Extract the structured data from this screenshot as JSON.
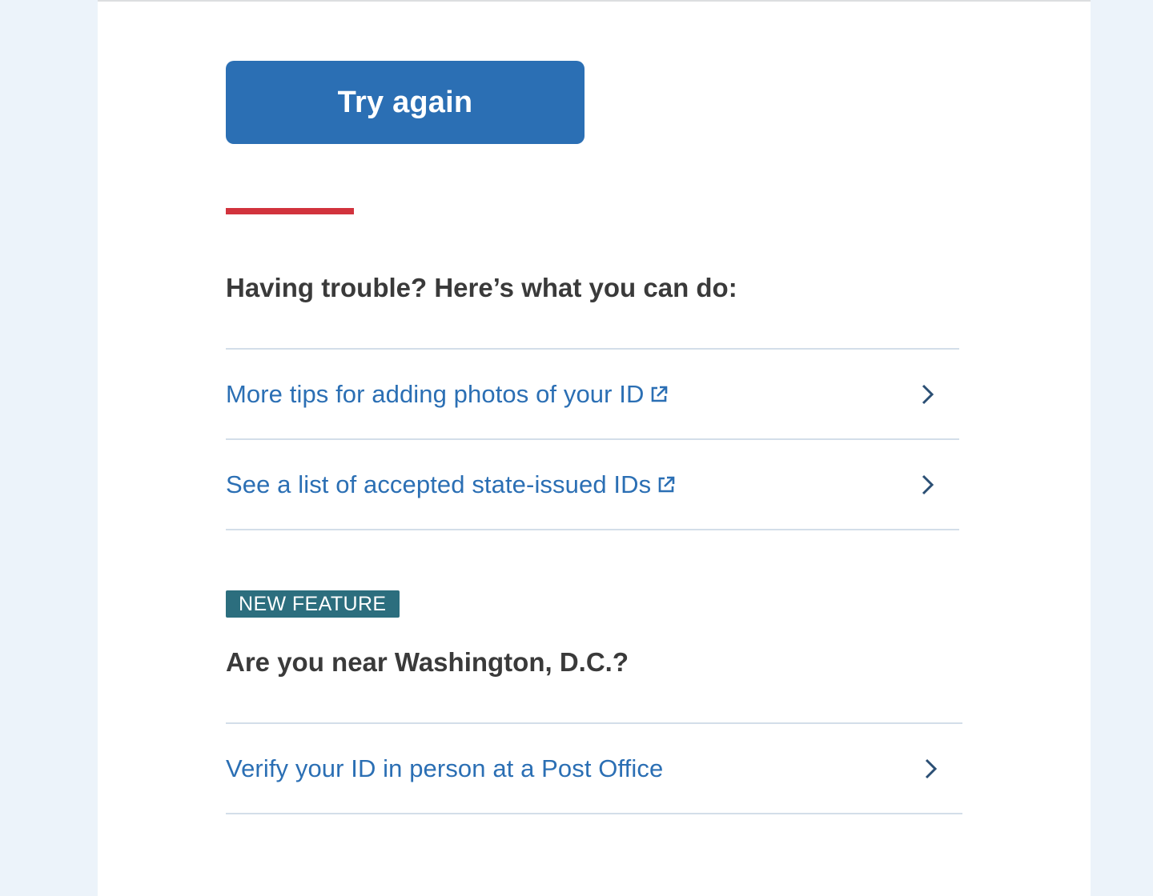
{
  "actions": {
    "try_again_label": "Try again"
  },
  "trouble_section": {
    "heading": "Having trouble? Here’s what you can do:",
    "links": [
      {
        "label": "More tips for adding photos of your ID",
        "external": true
      },
      {
        "label": "See a list of accepted state-issued IDs",
        "external": true
      }
    ]
  },
  "in_person_section": {
    "badge": "NEW FEATURE",
    "heading": "Are you near Washington, D.C.?",
    "links": [
      {
        "label": "Verify your ID in person at a Post Office",
        "external": false
      }
    ]
  },
  "colors": {
    "primary": "#2B6FB4",
    "accent_rule": "#D2333D",
    "badge": "#2C6E7E",
    "page_background": "#ECF3FA",
    "heading_text": "#3A3A3A",
    "divider": "#D3DEE9"
  },
  "icons": {
    "external_link": "external-link-icon",
    "chevron": "chevron-right-icon"
  }
}
